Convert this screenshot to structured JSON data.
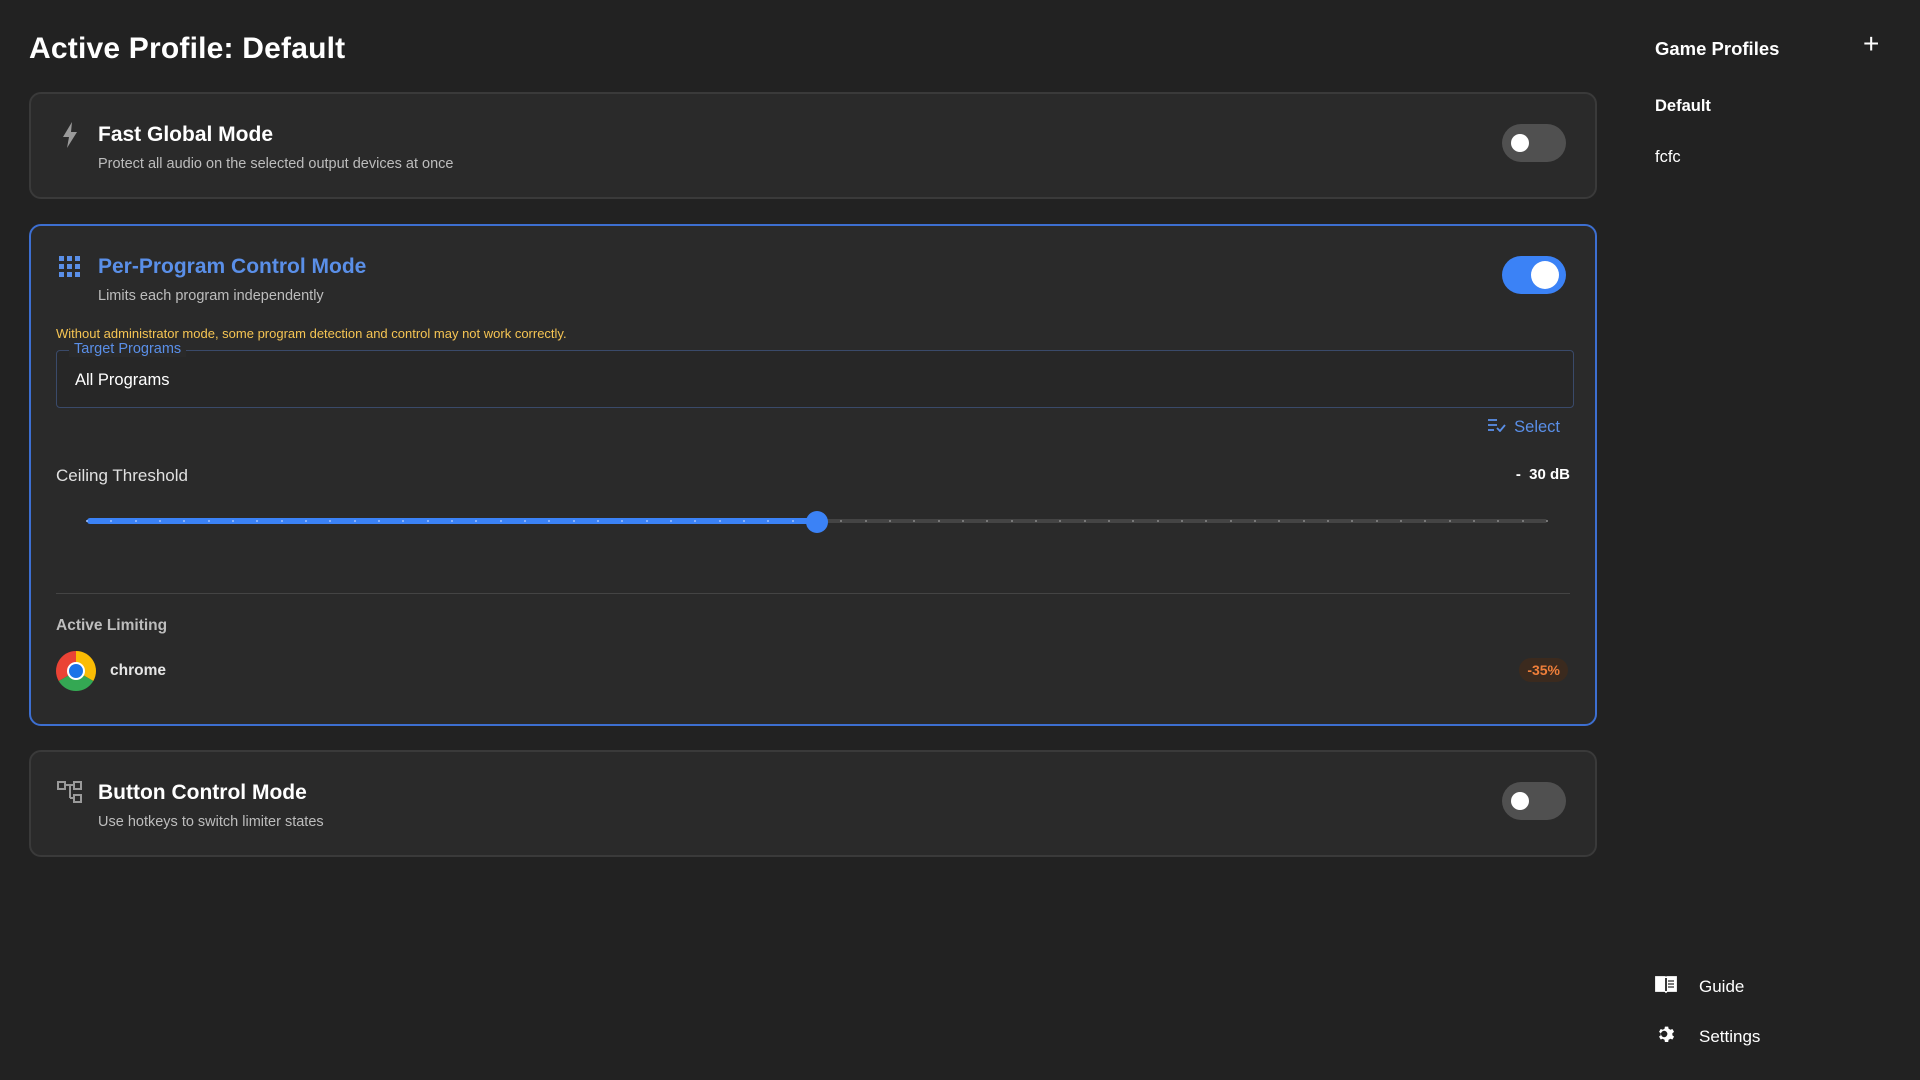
{
  "page": {
    "title": "Active Profile: Default"
  },
  "cards": {
    "fast_global": {
      "title": "Fast Global Mode",
      "subtitle": "Protect all audio on the selected output devices at once",
      "enabled": false,
      "icon": "lightning-icon"
    },
    "per_program": {
      "title": "Per-Program Control Mode",
      "subtitle": "Limits each program independently",
      "enabled": true,
      "icon": "grid-icon",
      "warning": "Without administrator mode, some program detection and control may not work correctly.",
      "target_programs_label": "Target Programs",
      "target_programs_value": "All Programs",
      "select_label": "Select",
      "threshold_label": "Ceiling Threshold",
      "threshold_value": "-  30 dB",
      "slider_fraction": 0.5,
      "active_limiting_label": "Active Limiting",
      "programs": [
        {
          "name": "chrome",
          "reduction": "-35%"
        }
      ]
    },
    "button_control": {
      "title": "Button Control Mode",
      "subtitle": "Use hotkeys to switch limiter states",
      "enabled": false,
      "icon": "hotkey-icon"
    }
  },
  "sidebar": {
    "title": "Game Profiles",
    "add_icon": "plus-icon",
    "profiles": [
      {
        "label": "Default",
        "selected": true
      },
      {
        "label": "fcfc",
        "selected": false
      }
    ],
    "guide_label": "Guide",
    "settings_label": "Settings"
  },
  "colors": {
    "accent": "#3b82f6",
    "background": "#222222",
    "card": "#2a2a2a",
    "warning": "#f5c453",
    "badge_text": "#f07f3a"
  }
}
